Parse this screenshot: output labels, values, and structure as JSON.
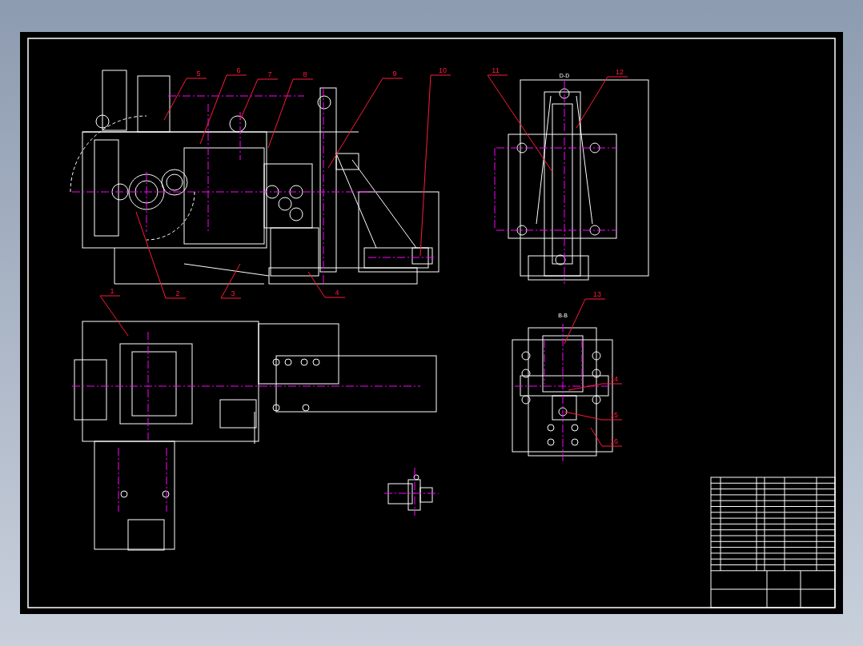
{
  "drawing": {
    "section_labels": [
      {
        "text": "D-D"
      },
      {
        "text": "B-B"
      }
    ],
    "part_numbers": [
      {
        "label": "1"
      },
      {
        "label": "2"
      },
      {
        "label": "3"
      },
      {
        "label": "4"
      },
      {
        "label": "5"
      },
      {
        "label": "6"
      },
      {
        "label": "7"
      },
      {
        "label": "8"
      },
      {
        "label": "9"
      },
      {
        "label": "10"
      },
      {
        "label": "11"
      },
      {
        "label": "12"
      },
      {
        "label": "13"
      },
      {
        "label": "14"
      },
      {
        "label": "15"
      },
      {
        "label": "16"
      }
    ]
  }
}
